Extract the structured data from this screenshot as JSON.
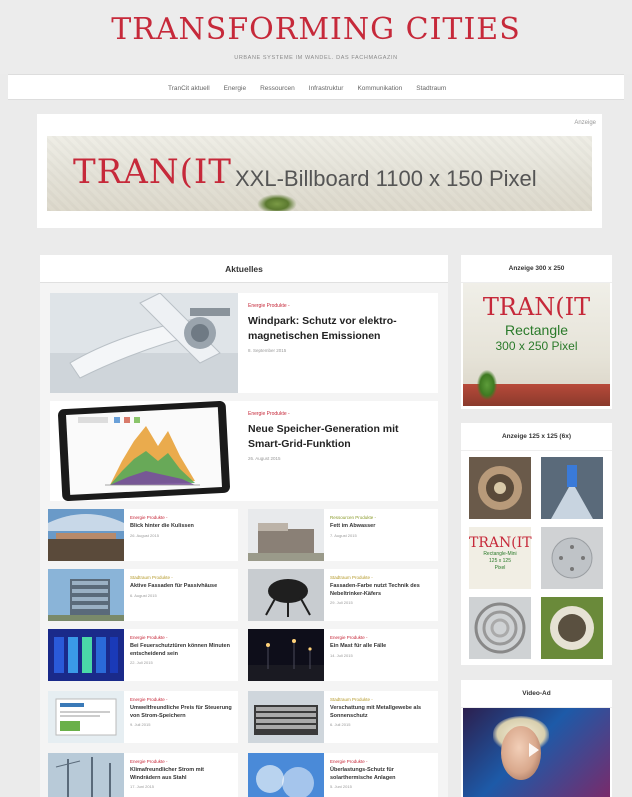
{
  "site": {
    "logo": "TRANSFORMING CITIES",
    "tagline": "URBANE SYSTEME IM WANDEL. DAS FACHMAGAZIN"
  },
  "nav": [
    "TranCit aktuell",
    "Energie",
    "Ressourcen",
    "Infrastruktur",
    "Kommunikation",
    "Stadtraum"
  ],
  "billboard": {
    "label": "Anzeige",
    "brand": "TRAN(IT",
    "text": "XXL-Billboard 1100 x 150 Pixel"
  },
  "section_title": "Aktuelles",
  "featured": [
    {
      "category": "Energie Produkte -",
      "title": "Windpark: Schutz vor elektro-magnetischen Emissionen",
      "date": "8. September 2015",
      "icon": "wind-turbine-image"
    },
    {
      "category": "Energie Produkte -",
      "title": "Neue Speicher-Generation mit Smart-Grid-Funktion",
      "date": "26. August 2015",
      "icon": "tablet-chart-image"
    }
  ],
  "articles": [
    {
      "category": "Energie Produkte -",
      "title": "Blick hinter die Kulissen",
      "date": "26. August 2015",
      "tone": "red"
    },
    {
      "category": "Ressourcen Produkte -",
      "title": "Fett im Abwasser",
      "date": "7. August 2015",
      "tone": "green"
    },
    {
      "category": "Stadtraum Produkte -",
      "title": "Aktive Fassaden für Passivhäuse",
      "date": "6. August 2015",
      "tone": "olive"
    },
    {
      "category": "Stadtraum Produkte -",
      "title": "Fassaden-Farbe nutzt Technik des Nebeltrinker-Käfers",
      "date": "29. Juli 2015",
      "tone": "olive"
    },
    {
      "category": "Energie Produkte -",
      "title": "Bei Feuerschutztüren können Minuten entscheidend sein",
      "date": "22. Juli 2015",
      "tone": "red"
    },
    {
      "category": "Energie Produkte -",
      "title": "Ein Mast für alle Fälle",
      "date": "14. Juli 2015",
      "tone": "red"
    },
    {
      "category": "Energie Produkte -",
      "title": "Umweltfreundliche Preis für Steuerung von Strom-Speichern",
      "date": "9. Juli 2015",
      "tone": "red"
    },
    {
      "category": "Stadtraum Produkte -",
      "title": "Verschattung mit Metallgewebe als Sonnenschutz",
      "date": "6. Juli 2015",
      "tone": "olive"
    },
    {
      "category": "Energie Produkte -",
      "title": "Klimafreundlicher Strom mit Windrädern aus Stahl",
      "date": "17. Juni 2015",
      "tone": "red"
    },
    {
      "category": "Energie Produkte -",
      "title": "Überlastungs-Schutz für solarthermische Anlagen",
      "date": "5. Juni 2015",
      "tone": "red"
    }
  ],
  "sidebar": {
    "rect_title": "Anzeige 300 x 250",
    "rect_brand": "TRAN(IT",
    "rect_line1": "Rectangle",
    "rect_line2": "300 x 250 Pixel",
    "tiles_title": "Anzeige 125 x 125 (6x)",
    "mini_brand": "TRAN(IT",
    "mini_line1": "Rectangle-Mini",
    "mini_line2": "125 x 125",
    "mini_line3": "Pixel",
    "video_title": "Video-Ad"
  },
  "colors": {
    "brand_red": "#c6293a",
    "category_green": "#8a9a2a",
    "category_olive": "#b59a2a",
    "ad_green": "#2a7a2a"
  }
}
